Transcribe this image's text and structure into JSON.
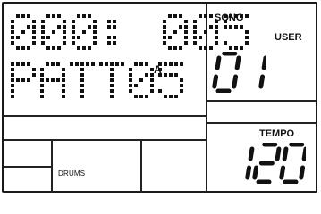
{
  "display": {
    "bar_position": "000: 005",
    "pattern_name": "PATT05",
    "pattern_variation": "A",
    "song_label": "SONG",
    "song_mode": "USER",
    "song_number": "01",
    "tempo_label": "TEMPO",
    "tempo_value": "120",
    "part_label": "DRUMS"
  },
  "colors": {
    "segment": "#111111",
    "background": "#ffffff",
    "frame": "#1a1a1a"
  }
}
